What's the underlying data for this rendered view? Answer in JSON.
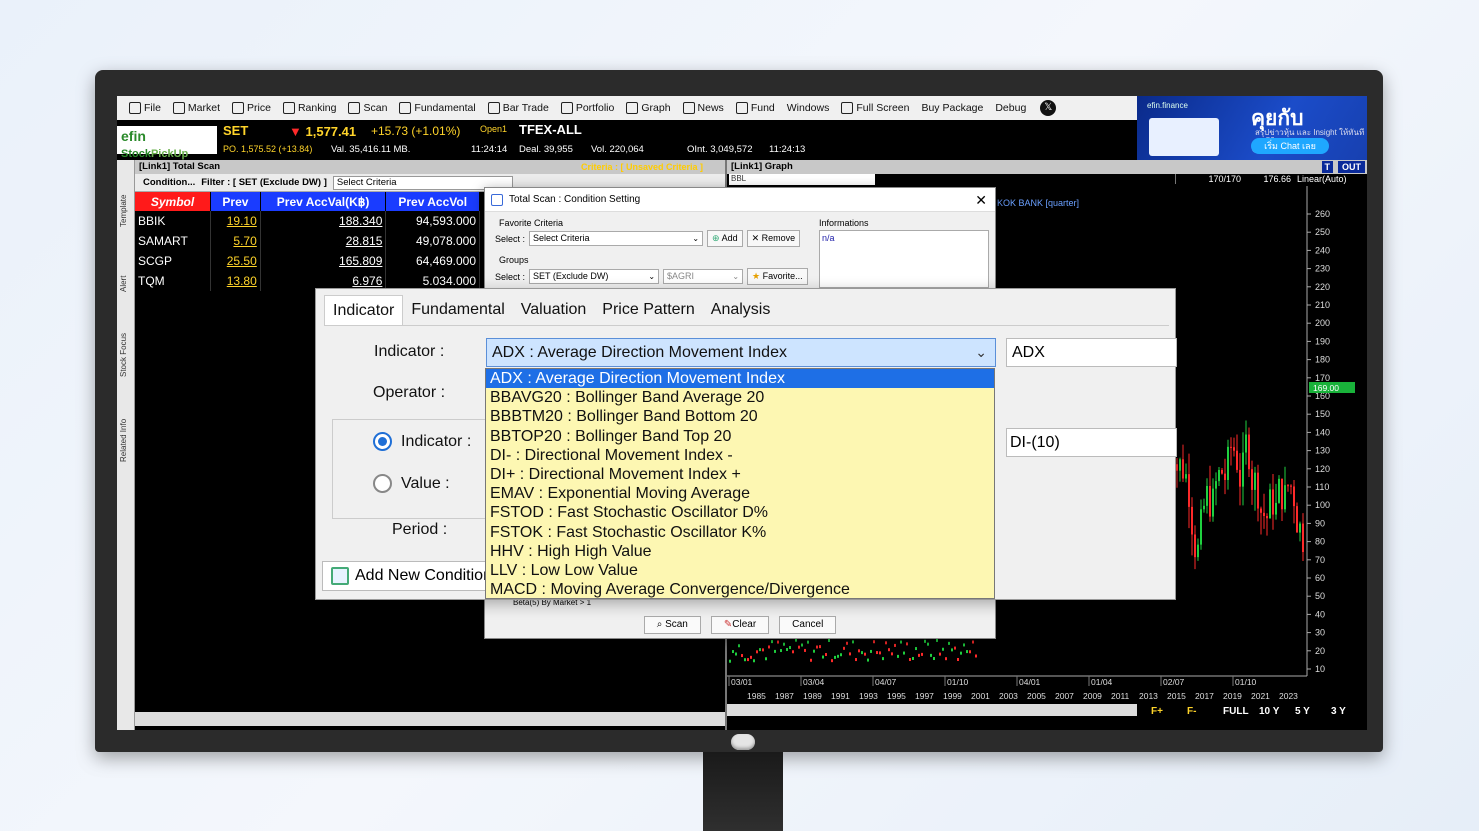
{
  "menu": [
    {
      "label": "File",
      "icon": "file-icon"
    },
    {
      "label": "Market",
      "icon": "market-icon"
    },
    {
      "label": "Price",
      "icon": "dollar-icon"
    },
    {
      "label": "Ranking",
      "icon": "ranking-icon"
    },
    {
      "label": "Scan",
      "icon": "scan-icon"
    },
    {
      "label": "Fundamental",
      "icon": "bar-chart-icon"
    },
    {
      "label": "Bar Trade",
      "icon": "bar-trade-icon"
    },
    {
      "label": "Portfolio",
      "icon": "portfolio-icon"
    },
    {
      "label": "Graph",
      "icon": "graph-icon"
    },
    {
      "label": "News",
      "icon": "news-icon"
    },
    {
      "label": "Fund",
      "icon": "fund-icon"
    },
    {
      "label": "Windows",
      "icon": ""
    },
    {
      "label": "Full Screen",
      "icon": "fullscreen-icon"
    },
    {
      "label": "Buy Package",
      "icon": ""
    },
    {
      "label": "Debug",
      "icon": ""
    }
  ],
  "ad": {
    "brand": "efin.finance",
    "headline": "คุยกับ efinAI",
    "sub": "สรุปข่าวหุ้น และ Insight ให้ทันที",
    "cta": "เริ่ม Chat เลย"
  },
  "logo": {
    "efin": "efin",
    "stock": "Stock",
    "pickup": "PickUp"
  },
  "ticker": {
    "set_label": "SET",
    "set_value": "1,577.41",
    "set_change": "+15.73 (+1.01%)",
    "open": "Open1",
    "po": "PO. 1,575.52 (+13.84)",
    "value": "Val. 35,416.11 MB.",
    "time1": "11:24:14",
    "tfex": "TFEX-ALL",
    "deal": "Deal. 39,955",
    "vol": "Vol. 220,064",
    "oint": "OInt. 3,049,572",
    "time2": "11:24:13"
  },
  "side_tabs": [
    "Template",
    "Alert",
    "Stock Focus",
    "Related Info"
  ],
  "scan": {
    "header": "[Link1] Total Scan",
    "criteria": "Criteria : [ Unsaved Criteria ]",
    "condition_btn": "Condition...",
    "filter_label": "Filter : [ SET (Exclude DW) ]",
    "select_criteria": "Select Criteria",
    "columns": [
      "Symbol",
      "Prev",
      "Prev AccVal(K฿)",
      "Prev AccVol"
    ],
    "rows": [
      {
        "symbol": "BBIK",
        "prev": "19.10",
        "accval": "188.340",
        "accvol": "94,593.000"
      },
      {
        "symbol": "SAMART",
        "prev": "5.70",
        "accval": "28.815",
        "accvol": "49,078.000"
      },
      {
        "symbol": "SCGP",
        "prev": "25.50",
        "accval": "165.809",
        "accvol": "64,469.000"
      },
      {
        "symbol": "TQM",
        "prev": "13.80",
        "accval": "6.976",
        "accvol": "5.034.000"
      }
    ]
  },
  "graph": {
    "header": "[Link1] Graph",
    "t_btn": "T",
    "out_btn": "OUT",
    "symbol": "BBL",
    "val1": "170/170",
    "val2": "176.66",
    "scale": "Linear(Auto)",
    "title": "KOK BANK [quarter]",
    "last_price": "169.00",
    "yticks": [
      "260",
      "250",
      "240",
      "230",
      "220",
      "210",
      "200",
      "190",
      "180",
      "170",
      "160",
      "150",
      "140",
      "130",
      "120",
      "110",
      "100",
      "90",
      "80",
      "70",
      "60",
      "50",
      "40",
      "30",
      "20",
      "10"
    ],
    "dates": [
      "03/01",
      "03/04",
      "04/07",
      "01/10",
      "04/01",
      "01/04",
      "02/07",
      "01/10"
    ],
    "years": [
      "1985",
      "1987",
      "1989",
      "1991",
      "1993",
      "1995",
      "1997",
      "1999",
      "2001",
      "2003",
      "2005",
      "2007",
      "2009",
      "2011",
      "2013",
      "2015",
      "2017",
      "2019",
      "2021",
      "2023"
    ],
    "ranges": [
      "F+",
      "F-",
      "FULL",
      "10 Y",
      "5 Y",
      "3 Y"
    ]
  },
  "modal": {
    "title": "Total Scan : Condition Setting",
    "favorite_label": "Favorite Criteria",
    "select_label": "Select :",
    "select_value": "Select Criteria",
    "add": "Add",
    "remove": "Remove",
    "groups_label": "Groups",
    "group_value": "SET (Exclude DW)",
    "group_sub": "$AGRI",
    "favorite_btn": "Favorite...",
    "info_label": "Informations",
    "info_value": "n/a",
    "row_text": "Beta(5) By Market > 1",
    "scan": "Scan",
    "clear": "Clear",
    "cancel": "Cancel"
  },
  "setting": {
    "tabs": [
      "Indicator",
      "Fundamental",
      "Valuation",
      "Price Pattern",
      "Analysis"
    ],
    "indicator_label": "Indicator :",
    "operator_label": "Operator :",
    "radio_indicator": "Indicator :",
    "radio_value": "Value :",
    "period_label": "Period :",
    "indicator_value": "ADX : Average Direction Movement Index",
    "adx_value": "ADX",
    "di_value": "DI-(10)",
    "add_condition": "Add New Condition"
  },
  "options": [
    "ADX : Average Direction Movement Index",
    "BBAVG20 : Bollinger Band Average 20",
    "BBBTM20 : Bollinger Band  Bottom 20",
    "BBTOP20 : Bollinger Band  Top 20",
    "DI- : Directional Movement Index -",
    "DI+ : Directional Movement Index +",
    "EMAV : Exponential Moving Average",
    "FSTOD : Fast Stochastic Oscillator D%",
    "FSTOK : Fast Stochastic Oscillator K%",
    "HHV : High High Value",
    "LLV : Low Low Value",
    "MACD : Moving Average Convergence/Divergence"
  ]
}
